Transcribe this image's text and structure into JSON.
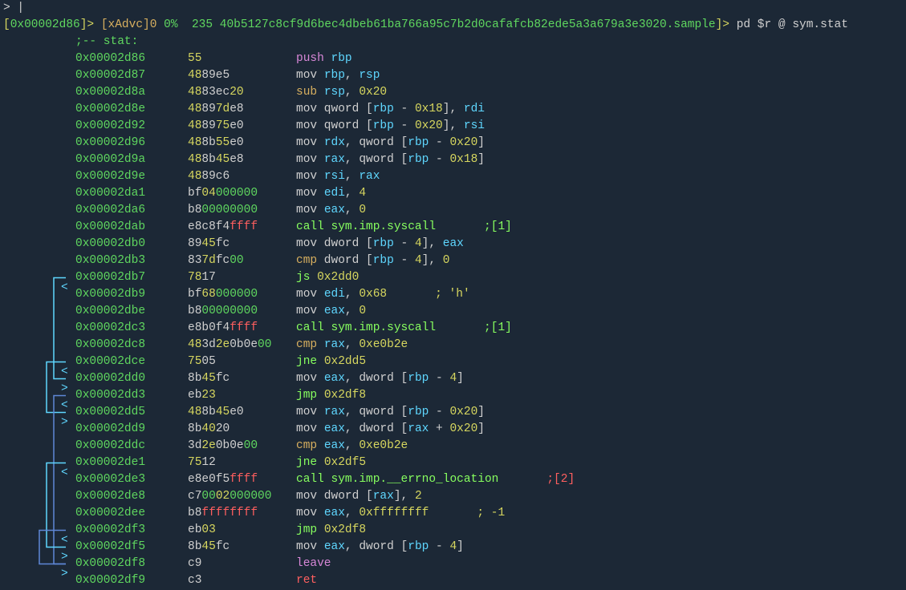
{
  "prompt_cursor": "|",
  "prompt": {
    "addr": "0x00002d86",
    "mode": "[xAdvc]0",
    "pct1": "0%",
    "pct2": "",
    "num": "235",
    "hash": "40b5127c8cf9d6bec4dbeb61ba766a95c7b2d0cafafcb82ede5a3a679a3e3020.sample",
    "cmd": "pd $r @ sym.stat"
  },
  "label": ";-- stat:",
  "rows": [
    {
      "a": "0x00002d86",
      "b": [
        [
          "55",
          "y"
        ]
      ],
      "asm": [
        [
          "push",
          "p"
        ],
        [
          " ",
          ""
        ],
        [
          "rbp",
          "c"
        ]
      ]
    },
    {
      "a": "0x00002d87",
      "b": [
        [
          "48",
          "y"
        ],
        [
          "89e5",
          ""
        ]
      ],
      "asm": [
        [
          "mov",
          "w"
        ],
        [
          " ",
          ""
        ],
        [
          "rbp",
          "c"
        ],
        [
          ", ",
          ""
        ],
        [
          "rsp",
          "c"
        ]
      ]
    },
    {
      "a": "0x00002d8a",
      "b": [
        [
          "48",
          "y"
        ],
        [
          "83ec",
          ""
        ],
        [
          "20",
          "y"
        ]
      ],
      "asm": [
        [
          "sub",
          "o"
        ],
        [
          " ",
          ""
        ],
        [
          "rsp",
          "c"
        ],
        [
          ", ",
          ""
        ],
        [
          "0x20",
          "y"
        ]
      ]
    },
    {
      "a": "0x00002d8e",
      "b": [
        [
          "48",
          "y"
        ],
        [
          "89",
          ""
        ],
        [
          "7d",
          "y"
        ],
        [
          "e8",
          ""
        ]
      ],
      "asm": [
        [
          "mov",
          "w"
        ],
        [
          " qword [",
          ""
        ],
        [
          "rbp",
          "c"
        ],
        [
          " - ",
          ""
        ],
        [
          "0x18",
          "y"
        ],
        [
          "], ",
          ""
        ],
        [
          "rdi",
          "c"
        ]
      ]
    },
    {
      "a": "0x00002d92",
      "b": [
        [
          "48",
          "y"
        ],
        [
          "89",
          ""
        ],
        [
          "75",
          "y"
        ],
        [
          "e0",
          ""
        ]
      ],
      "asm": [
        [
          "mov",
          "w"
        ],
        [
          " qword [",
          ""
        ],
        [
          "rbp",
          "c"
        ],
        [
          " - ",
          ""
        ],
        [
          "0x20",
          "y"
        ],
        [
          "], ",
          ""
        ],
        [
          "rsi",
          "c"
        ]
      ]
    },
    {
      "a": "0x00002d96",
      "b": [
        [
          "48",
          "y"
        ],
        [
          "8b",
          ""
        ],
        [
          "55",
          "y"
        ],
        [
          "e0",
          ""
        ]
      ],
      "asm": [
        [
          "mov",
          "w"
        ],
        [
          " ",
          ""
        ],
        [
          "rdx",
          "c"
        ],
        [
          ", qword [",
          ""
        ],
        [
          "rbp",
          "c"
        ],
        [
          " - ",
          ""
        ],
        [
          "0x20",
          "y"
        ],
        [
          "]",
          ""
        ]
      ]
    },
    {
      "a": "0x00002d9a",
      "b": [
        [
          "48",
          "y"
        ],
        [
          "8b",
          ""
        ],
        [
          "45",
          "y"
        ],
        [
          "e8",
          ""
        ]
      ],
      "asm": [
        [
          "mov",
          "w"
        ],
        [
          " ",
          ""
        ],
        [
          "rax",
          "c"
        ],
        [
          ", qword [",
          ""
        ],
        [
          "rbp",
          "c"
        ],
        [
          " - ",
          ""
        ],
        [
          "0x18",
          "y"
        ],
        [
          "]",
          ""
        ]
      ]
    },
    {
      "a": "0x00002d9e",
      "b": [
        [
          "48",
          "y"
        ],
        [
          "89c6",
          ""
        ]
      ],
      "asm": [
        [
          "mov",
          "w"
        ],
        [
          " ",
          ""
        ],
        [
          "rsi",
          "c"
        ],
        [
          ", ",
          ""
        ],
        [
          "rax",
          "c"
        ]
      ]
    },
    {
      "a": "0x00002da1",
      "b": [
        [
          "bf",
          ""
        ],
        [
          "04",
          "y"
        ],
        [
          "000000",
          "g"
        ]
      ],
      "asm": [
        [
          "mov",
          "w"
        ],
        [
          " ",
          ""
        ],
        [
          "edi",
          "c"
        ],
        [
          ", ",
          ""
        ],
        [
          "4",
          "y"
        ]
      ]
    },
    {
      "a": "0x00002da6",
      "b": [
        [
          "b8",
          ""
        ],
        [
          "00000000",
          "g"
        ]
      ],
      "asm": [
        [
          "mov",
          "w"
        ],
        [
          " ",
          ""
        ],
        [
          "eax",
          "c"
        ],
        [
          ", ",
          ""
        ],
        [
          "0",
          "y"
        ]
      ]
    },
    {
      "a": "0x00002dab",
      "b": [
        [
          "e8c8f4",
          ""
        ],
        [
          "ffff",
          "r"
        ]
      ],
      "asm": [
        [
          "call",
          "bg"
        ],
        [
          " ",
          ""
        ],
        [
          "sym.imp.syscall",
          "bg"
        ]
      ],
      "cmt": ";[1]",
      "cc": "bg"
    },
    {
      "a": "0x00002db0",
      "b": [
        [
          "89",
          ""
        ],
        [
          "45",
          "y"
        ],
        [
          "fc",
          ""
        ]
      ],
      "asm": [
        [
          "mov",
          "w"
        ],
        [
          " dword [",
          ""
        ],
        [
          "rbp",
          "c"
        ],
        [
          " - ",
          ""
        ],
        [
          "4",
          "y"
        ],
        [
          "], ",
          ""
        ],
        [
          "eax",
          "c"
        ]
      ]
    },
    {
      "a": "0x00002db3",
      "b": [
        [
          "83",
          ""
        ],
        [
          "7d",
          "y"
        ],
        [
          "fc",
          ""
        ],
        [
          "00",
          "g"
        ]
      ],
      "asm": [
        [
          "cmp",
          "o"
        ],
        [
          " dword [",
          ""
        ],
        [
          "rbp",
          "c"
        ],
        [
          " - ",
          ""
        ],
        [
          "4",
          "y"
        ],
        [
          "], ",
          ""
        ],
        [
          "0",
          "y"
        ]
      ]
    },
    {
      "a": "0x00002db7",
      "b": [
        [
          "78",
          "y"
        ],
        [
          "17",
          ""
        ]
      ],
      "asm": [
        [
          "js",
          "bg"
        ],
        [
          " ",
          ""
        ],
        [
          "0x2dd0",
          "y"
        ]
      ],
      "in": "<"
    },
    {
      "a": "0x00002db9",
      "b": [
        [
          "bf",
          ""
        ],
        [
          "68",
          "y"
        ],
        [
          "000000",
          "g"
        ]
      ],
      "asm": [
        [
          "mov",
          "w"
        ],
        [
          " ",
          ""
        ],
        [
          "edi",
          "c"
        ],
        [
          ", ",
          ""
        ],
        [
          "0x68",
          "y"
        ]
      ],
      "cmt": "; 'h'",
      "cc": "y"
    },
    {
      "a": "0x00002dbe",
      "b": [
        [
          "b8",
          ""
        ],
        [
          "00000000",
          "g"
        ]
      ],
      "asm": [
        [
          "mov",
          "w"
        ],
        [
          " ",
          ""
        ],
        [
          "eax",
          "c"
        ],
        [
          ", ",
          ""
        ],
        [
          "0",
          "y"
        ]
      ]
    },
    {
      "a": "0x00002dc3",
      "b": [
        [
          "e8b0f4",
          ""
        ],
        [
          "ffff",
          "r"
        ]
      ],
      "asm": [
        [
          "call",
          "bg"
        ],
        [
          " ",
          ""
        ],
        [
          "sym.imp.syscall",
          "bg"
        ]
      ],
      "cmt": ";[1]",
      "cc": "bg"
    },
    {
      "a": "0x00002dc8",
      "b": [
        [
          "48",
          "y"
        ],
        [
          "3d",
          ""
        ],
        [
          "2e",
          "y"
        ],
        [
          "0b0e",
          ""
        ],
        [
          "00",
          "g"
        ]
      ],
      "asm": [
        [
          "cmp",
          "o"
        ],
        [
          " ",
          ""
        ],
        [
          "rax",
          "c"
        ],
        [
          ", ",
          ""
        ],
        [
          "0xe0b2e",
          "y"
        ]
      ]
    },
    {
      "a": "0x00002dce",
      "b": [
        [
          "75",
          "y"
        ],
        [
          "05",
          ""
        ]
      ],
      "asm": [
        [
          "jne",
          "bg"
        ],
        [
          " ",
          ""
        ],
        [
          "0x2dd5",
          "y"
        ]
      ],
      "in": "<"
    },
    {
      "a": "0x00002dd0",
      "b": [
        [
          "8b",
          ""
        ],
        [
          "45",
          "y"
        ],
        [
          "fc",
          ""
        ]
      ],
      "asm": [
        [
          "mov",
          "w"
        ],
        [
          " ",
          ""
        ],
        [
          "eax",
          "c"
        ],
        [
          ", dword [",
          ""
        ],
        [
          "rbp",
          "c"
        ],
        [
          " - ",
          ""
        ],
        [
          "4",
          "y"
        ],
        [
          "]",
          ""
        ]
      ],
      "in": ">"
    },
    {
      "a": "0x00002dd3",
      "b": [
        [
          "eb",
          ""
        ],
        [
          "23",
          "y"
        ]
      ],
      "asm": [
        [
          "jmp",
          "bg"
        ],
        [
          " ",
          ""
        ],
        [
          "0x2df8",
          "y"
        ]
      ],
      "in": "<"
    },
    {
      "a": "0x00002dd5",
      "b": [
        [
          "48",
          "y"
        ],
        [
          "8b",
          ""
        ],
        [
          "45",
          "y"
        ],
        [
          "e0",
          ""
        ]
      ],
      "asm": [
        [
          "mov",
          "w"
        ],
        [
          " ",
          ""
        ],
        [
          "rax",
          "c"
        ],
        [
          ", qword [",
          ""
        ],
        [
          "rbp",
          "c"
        ],
        [
          " - ",
          ""
        ],
        [
          "0x20",
          "y"
        ],
        [
          "]",
          ""
        ]
      ],
      "in": ">"
    },
    {
      "a": "0x00002dd9",
      "b": [
        [
          "8b",
          ""
        ],
        [
          "40",
          "y"
        ],
        [
          "20",
          ""
        ]
      ],
      "asm": [
        [
          "mov",
          "w"
        ],
        [
          " ",
          ""
        ],
        [
          "eax",
          "c"
        ],
        [
          ", dword [",
          ""
        ],
        [
          "rax",
          "c"
        ],
        [
          " + ",
          ""
        ],
        [
          "0x20",
          "y"
        ],
        [
          "]",
          ""
        ]
      ]
    },
    {
      "a": "0x00002ddc",
      "b": [
        [
          "3d",
          ""
        ],
        [
          "2e",
          "y"
        ],
        [
          "0b0e",
          ""
        ],
        [
          "00",
          "g"
        ]
      ],
      "asm": [
        [
          "cmp",
          "o"
        ],
        [
          " ",
          ""
        ],
        [
          "eax",
          "c"
        ],
        [
          ", ",
          ""
        ],
        [
          "0xe0b2e",
          "y"
        ]
      ]
    },
    {
      "a": "0x00002de1",
      "b": [
        [
          "75",
          "y"
        ],
        [
          "12",
          ""
        ]
      ],
      "asm": [
        [
          "jne",
          "bg"
        ],
        [
          " ",
          ""
        ],
        [
          "0x2df5",
          "y"
        ]
      ],
      "in": "<"
    },
    {
      "a": "0x00002de3",
      "b": [
        [
          "e8e0f5",
          ""
        ],
        [
          "ffff",
          "r"
        ]
      ],
      "asm": [
        [
          "call",
          "bg"
        ],
        [
          " ",
          ""
        ],
        [
          "sym.imp.__errno_location",
          "bg"
        ]
      ],
      "cmt": ";[2]",
      "cc": "r"
    },
    {
      "a": "0x00002de8",
      "b": [
        [
          "c7",
          ""
        ],
        [
          "00",
          "g"
        ],
        [
          "02",
          "y"
        ],
        [
          "000000",
          "g"
        ]
      ],
      "asm": [
        [
          "mov",
          "w"
        ],
        [
          " dword [",
          ""
        ],
        [
          "rax",
          "c"
        ],
        [
          "], ",
          ""
        ],
        [
          "2",
          "y"
        ]
      ]
    },
    {
      "a": "0x00002dee",
      "b": [
        [
          "b8",
          ""
        ],
        [
          "ffffffff",
          "r"
        ]
      ],
      "asm": [
        [
          "mov",
          "w"
        ],
        [
          " ",
          ""
        ],
        [
          "eax",
          "c"
        ],
        [
          ", ",
          ""
        ],
        [
          "0xffffffff",
          "y"
        ]
      ],
      "cmt": "; -1",
      "cc": "y"
    },
    {
      "a": "0x00002df3",
      "b": [
        [
          "eb",
          ""
        ],
        [
          "03",
          "y"
        ]
      ],
      "asm": [
        [
          "jmp",
          "bg"
        ],
        [
          " ",
          ""
        ],
        [
          "0x2df8",
          "y"
        ]
      ],
      "in": "<"
    },
    {
      "a": "0x00002df5",
      "b": [
        [
          "8b",
          ""
        ],
        [
          "45",
          "y"
        ],
        [
          "fc",
          ""
        ]
      ],
      "asm": [
        [
          "mov",
          "w"
        ],
        [
          " ",
          ""
        ],
        [
          "eax",
          "c"
        ],
        [
          ", dword [",
          ""
        ],
        [
          "rbp",
          "c"
        ],
        [
          " - ",
          ""
        ],
        [
          "4",
          "y"
        ],
        [
          "]",
          ""
        ]
      ],
      "in": ">"
    },
    {
      "a": "0x00002df8",
      "b": [
        [
          "c9",
          ""
        ]
      ],
      "asm": [
        [
          "leave",
          "p"
        ]
      ],
      "in": ">"
    },
    {
      "a": "0x00002df9",
      "b": [
        [
          "c3",
          ""
        ]
      ],
      "asm": [
        [
          "ret",
          "r"
        ]
      ]
    }
  ],
  "arrows": [
    {
      "from": 13,
      "to": 19,
      "x": 63,
      "cls": "p-cyan"
    },
    {
      "from": 18,
      "to": 21,
      "x": 54,
      "cls": "p-cyan"
    },
    {
      "from": 20,
      "to": 30,
      "x": 63,
      "cls": "p-blue"
    },
    {
      "from": 24,
      "to": 29,
      "x": 54,
      "cls": "p-cyan"
    },
    {
      "from": 28,
      "to": 30,
      "x": 45,
      "cls": "p-blue"
    }
  ]
}
